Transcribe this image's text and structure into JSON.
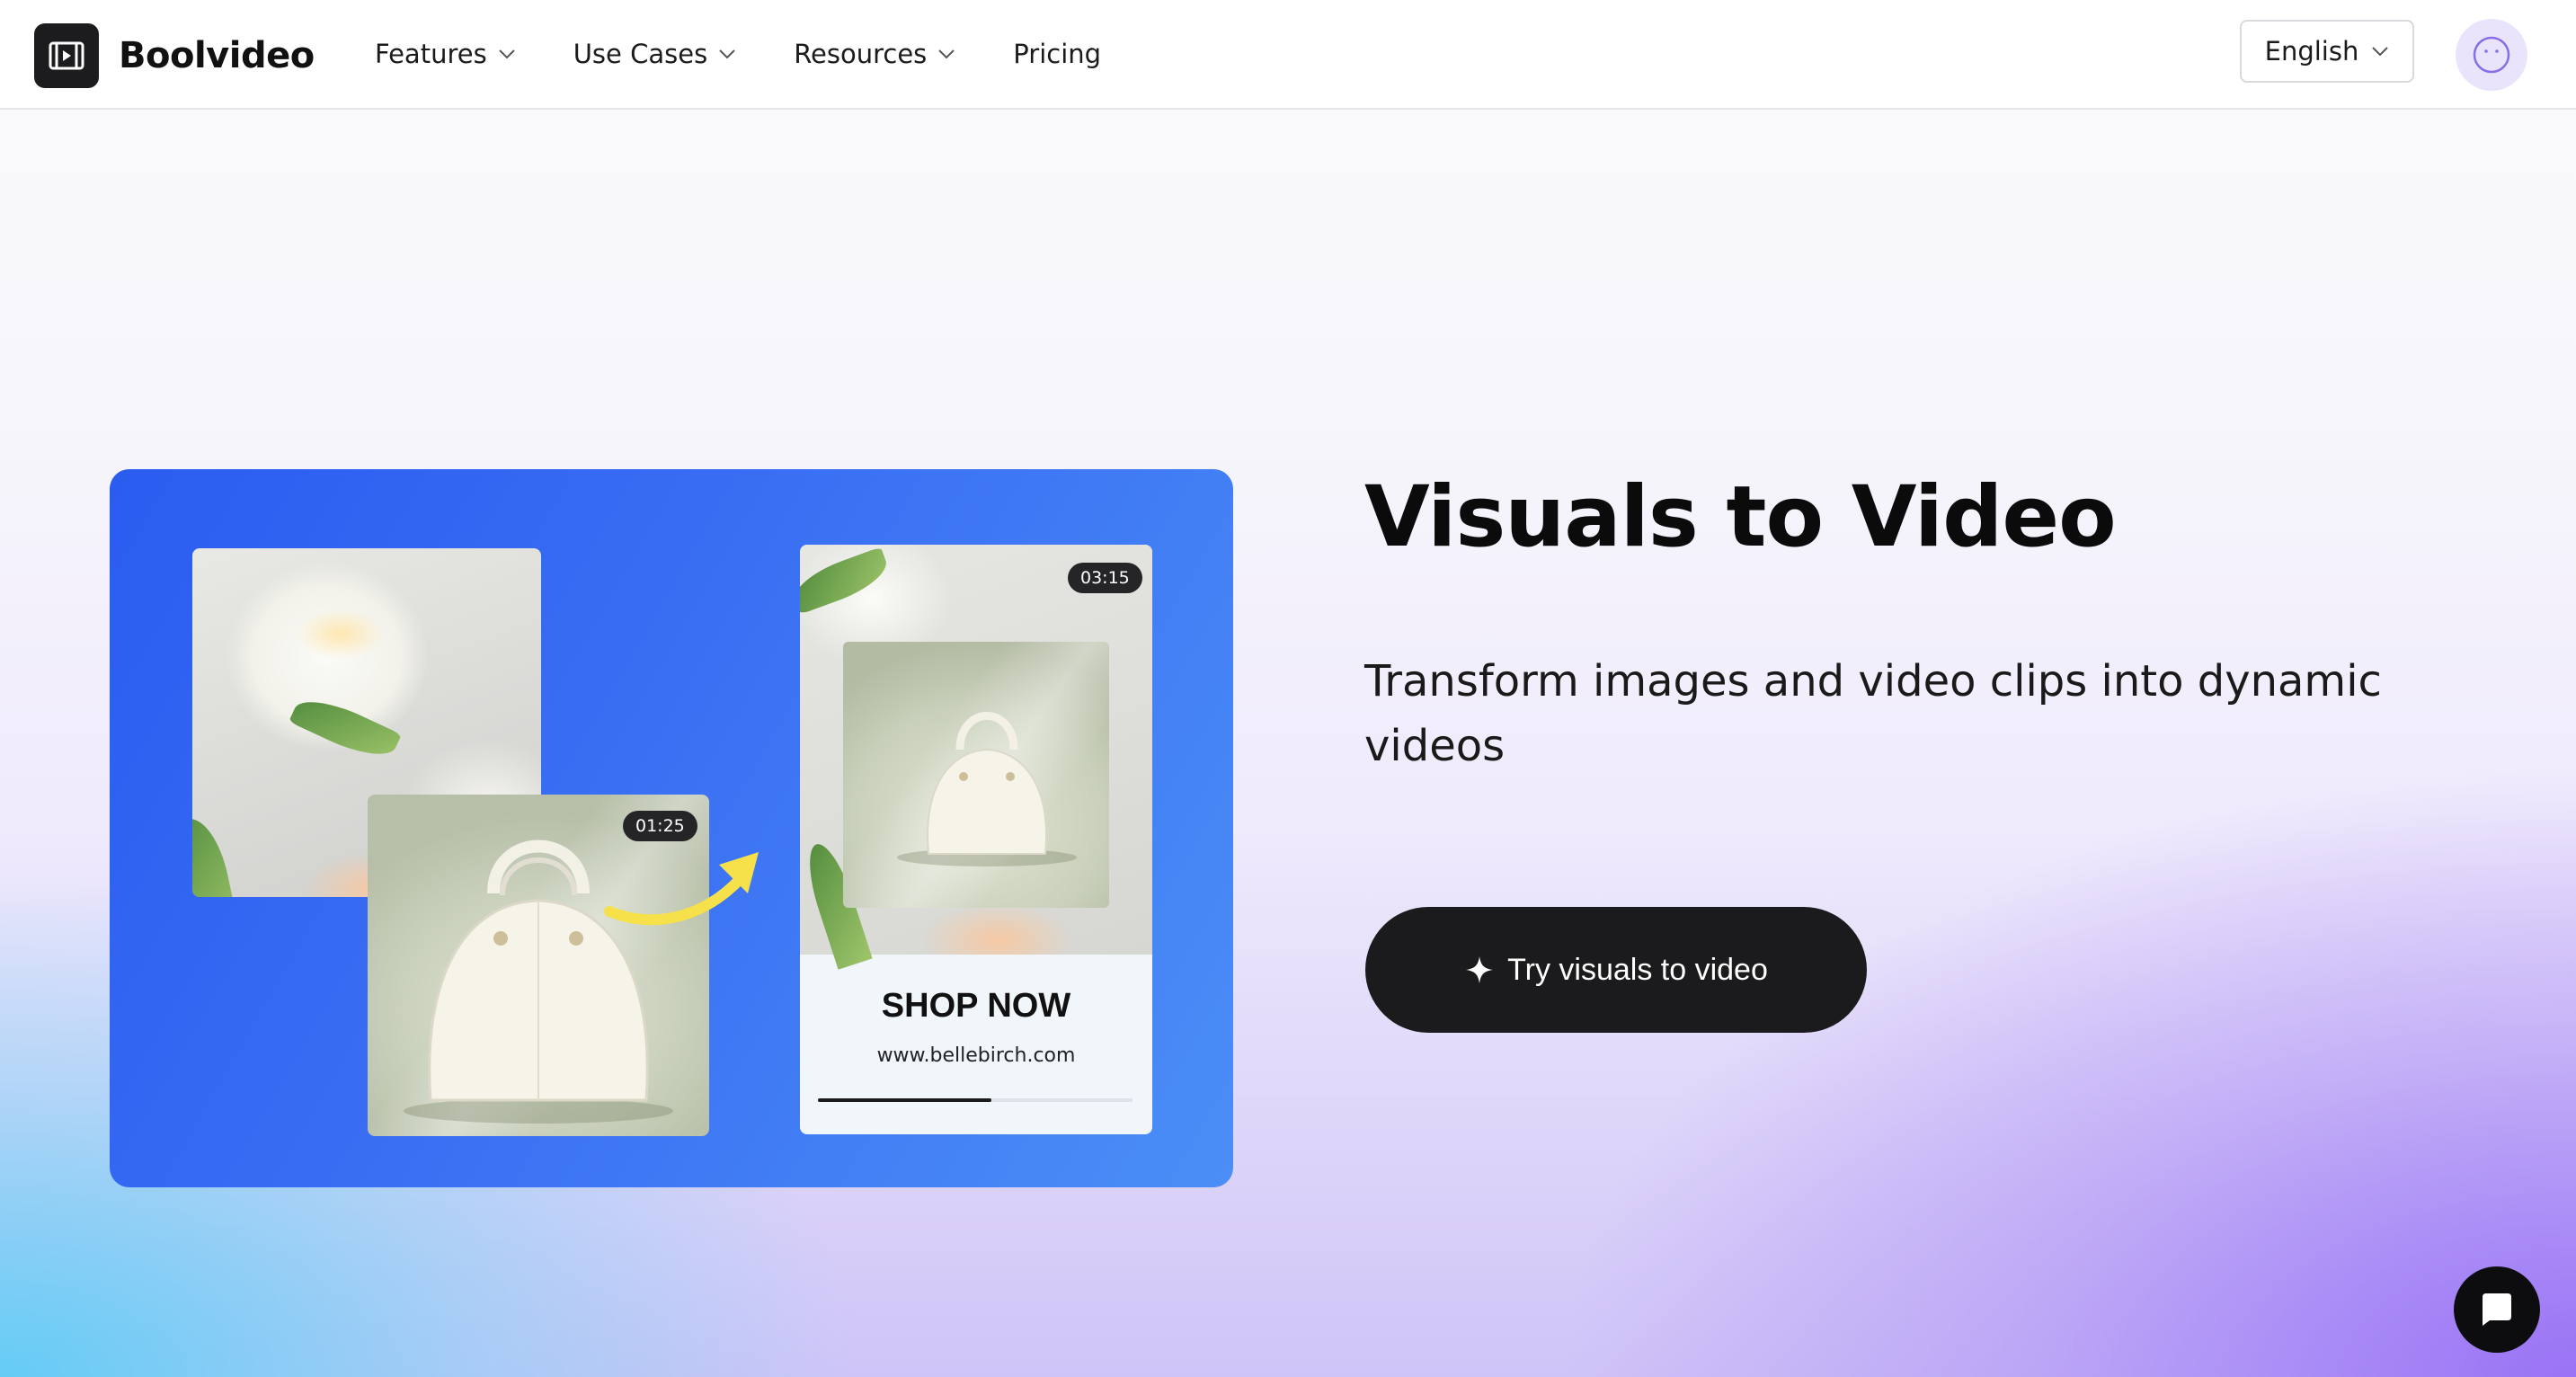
{
  "brand": {
    "name": "Boolvideo",
    "logo_icon": "film-play-icon"
  },
  "nav": {
    "items": [
      {
        "label": "Features",
        "has_dropdown": true
      },
      {
        "label": "Use Cases",
        "has_dropdown": true
      },
      {
        "label": "Resources",
        "has_dropdown": true
      },
      {
        "label": "Pricing",
        "has_dropdown": false
      }
    ]
  },
  "language": {
    "selected": "English"
  },
  "user": {
    "avatar_icon": "smiley-face-icon"
  },
  "hero": {
    "title": "Visuals to Video",
    "subtitle": "Transform images and video clips into dynamic videos",
    "cta_label": "Try visuals to video",
    "cta_icon": "sparkle-icon"
  },
  "preview": {
    "input_duration": "01:25",
    "output_duration": "03:15",
    "shop_title": "SHOP NOW",
    "shop_url": "www.bellebirch.com",
    "progress": 0.55
  },
  "chat": {
    "icon": "chat-bubble-icon"
  },
  "colors": {
    "card_blue": "#2a5cf0",
    "dark": "#1b1b1d",
    "arrow_yellow": "#f7e14a",
    "avatar_bg": "#e9e4fb",
    "avatar_stroke": "#8a6ee6"
  }
}
